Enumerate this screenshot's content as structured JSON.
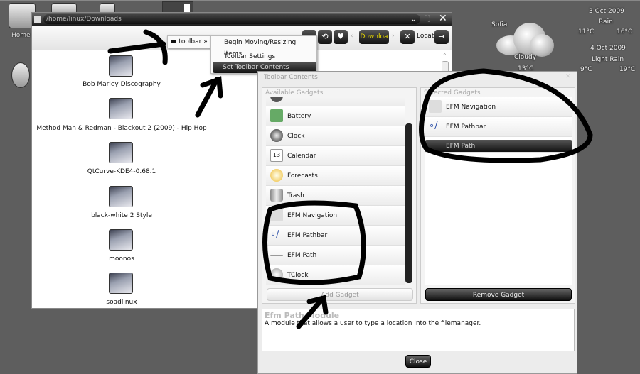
{
  "desktop": {
    "home_label": "Home"
  },
  "file_manager": {
    "path": "/home/linux/Downloads",
    "toolbar": {
      "location_tab": "Downloa",
      "location_label": "Locat"
    },
    "folders": [
      "Bob Marley Discography",
      "Method Man & Redman - Blackout 2 (2009) - Hip Hop",
      "QtCurve-KDE4-0.68.1",
      "black-white 2 Style",
      "moonos",
      "soadlinux"
    ]
  },
  "context_menu": {
    "parent": "toolbar",
    "items": [
      "Begin Moving/Resizing Items",
      "Toolbar Settings",
      "Set Toolbar Contents"
    ],
    "selected": "Set Toolbar Contents"
  },
  "dialog": {
    "title": "Toolbar Contents",
    "available_header": "Available Gadgets",
    "selected_header": "Selected Gadgets",
    "available": [
      {
        "label": "Battery",
        "icon": "battery-icon"
      },
      {
        "label": "Clock",
        "icon": "clock-icon"
      },
      {
        "label": "Calendar",
        "icon": "calendar-icon",
        "icon_text": "13"
      },
      {
        "label": "Forecasts",
        "icon": "forecast-icon"
      },
      {
        "label": "Trash",
        "icon": "trash-icon"
      },
      {
        "label": "EFM Navigation",
        "icon": "navigation-icon"
      },
      {
        "label": "EFM Pathbar",
        "icon": "pathbar-icon"
      },
      {
        "label": "EFM Path",
        "icon": "path-icon"
      },
      {
        "label": "TClock",
        "icon": "tclock-icon"
      }
    ],
    "selected": [
      {
        "label": "EFM Navigation"
      },
      {
        "label": "EFM Pathbar"
      },
      {
        "label": "EFM Path",
        "active": true
      }
    ],
    "add_button": "Add Gadget",
    "remove_button": "Remove Gadget",
    "desc_title": "Efm Path Module",
    "desc_text": "A module that allows a user to type a location into the filemanager.",
    "close_button": "Close"
  },
  "weather": {
    "city": "Sofia",
    "condition": "Cloudy",
    "temp": "13°C",
    "forecast": [
      {
        "date": "3 Oct 2009",
        "condition": "Rain",
        "low": "11°C",
        "high": "16°C"
      },
      {
        "date": "4 Oct 2009",
        "condition": "Light Rain",
        "low": "9°C",
        "high": "19°C"
      }
    ]
  }
}
